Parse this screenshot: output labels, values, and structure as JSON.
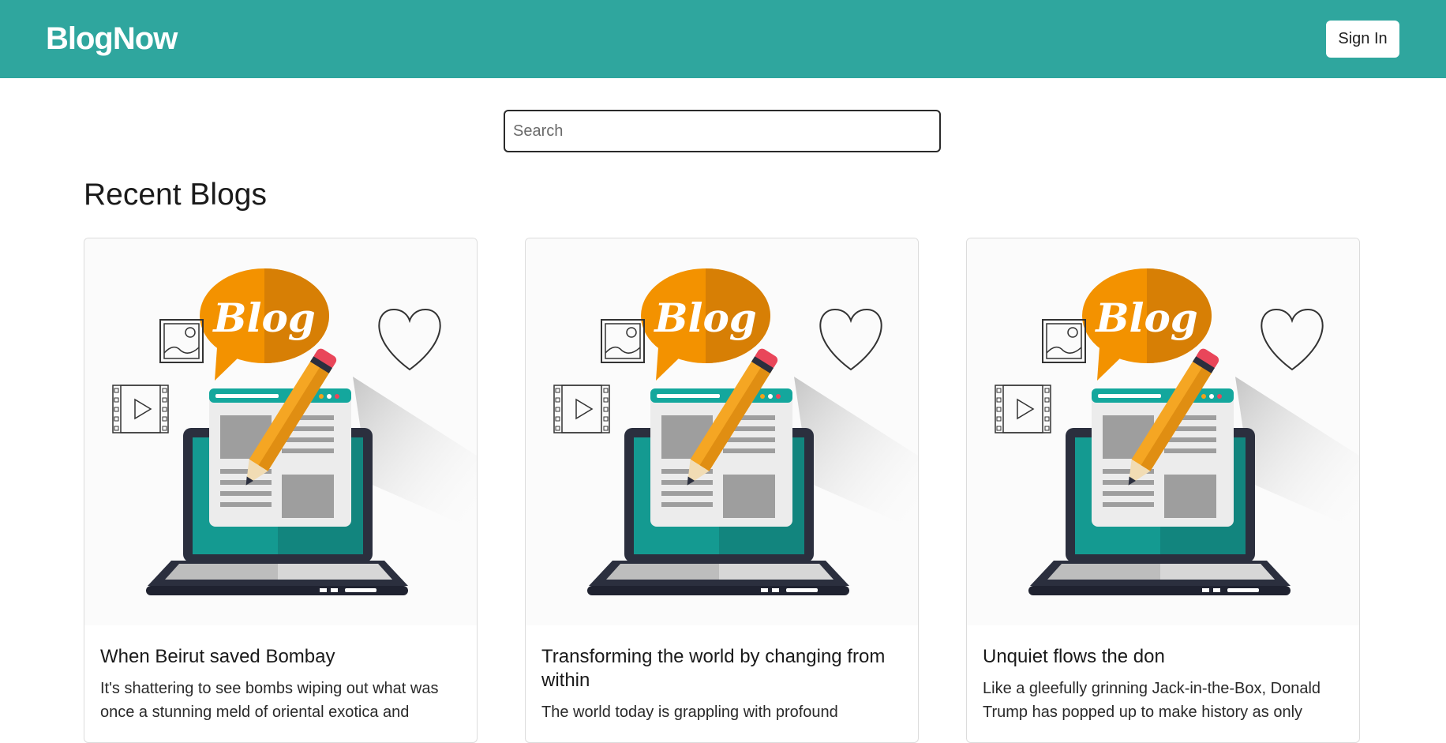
{
  "header": {
    "brand": "BlogNow",
    "signin_label": "Sign In",
    "bg_color": "#2fa69e"
  },
  "search": {
    "placeholder": "Search",
    "value": ""
  },
  "section_title": "Recent Blogs",
  "blogs": [
    {
      "title": "When Beirut saved Bombay",
      "excerpt": "It's shattering to see bombs wiping out what was once a stunning meld of oriental exotica and",
      "image_text": "Blog"
    },
    {
      "title": "Transforming the world by changing from within",
      "excerpt": "The world today is grappling with profound",
      "image_text": "Blog"
    },
    {
      "title": "Unquiet flows the don",
      "excerpt": "Like a gleefully grinning Jack-in-the-Box, Donald Trump has popped up to make history as only",
      "image_text": "Blog"
    }
  ]
}
